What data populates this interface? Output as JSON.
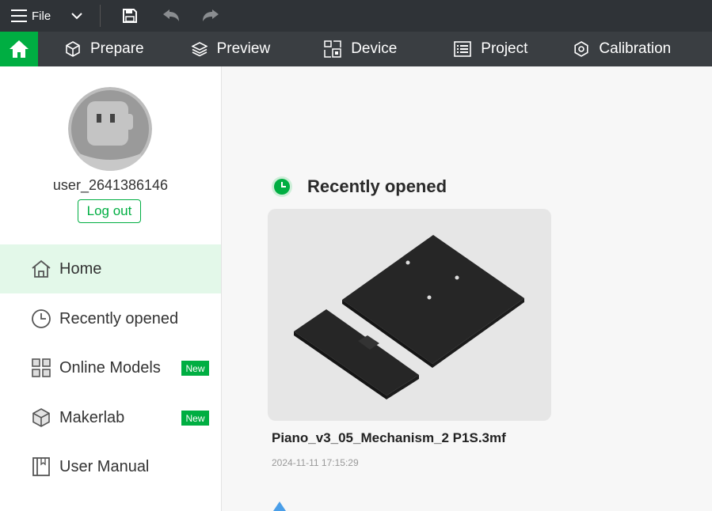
{
  "titlebar": {
    "file_label": "File",
    "icons": [
      "hamburger-menu-icon",
      "chevron-down-icon",
      "save-icon",
      "undo-icon",
      "redo-icon"
    ]
  },
  "tabs": [
    {
      "label": "Prepare",
      "icon": "cube-icon"
    },
    {
      "label": "Preview",
      "icon": "layers-icon"
    },
    {
      "label": "Device",
      "icon": "device-icon"
    },
    {
      "label": "Project",
      "icon": "list-icon"
    },
    {
      "label": "Calibration",
      "icon": "calibration-icon"
    }
  ],
  "sidebar": {
    "username": "user_2641386146",
    "logout_label": "Log out",
    "items": [
      {
        "label": "Home",
        "icon": "home-icon",
        "active": true
      },
      {
        "label": "Recently opened",
        "icon": "clock-icon"
      },
      {
        "label": "Online Models",
        "icon": "cubes-icon",
        "badge": "New"
      },
      {
        "label": "Makerlab",
        "icon": "makerlab-icon",
        "badge": "New"
      },
      {
        "label": "User Manual",
        "icon": "book-icon"
      }
    ]
  },
  "main": {
    "section_title": "Recently opened",
    "section_icon": "clock-icon",
    "recent": [
      {
        "name": "Piano_v3_05_Mechanism_2 P1S.3mf",
        "date": "2024-11-11 17:15:29"
      }
    ]
  },
  "colors": {
    "accent": "#00ae42",
    "titlebar": "#2f3337",
    "tabbar": "#3a3e42",
    "active_nav": "#e3f8e9"
  }
}
